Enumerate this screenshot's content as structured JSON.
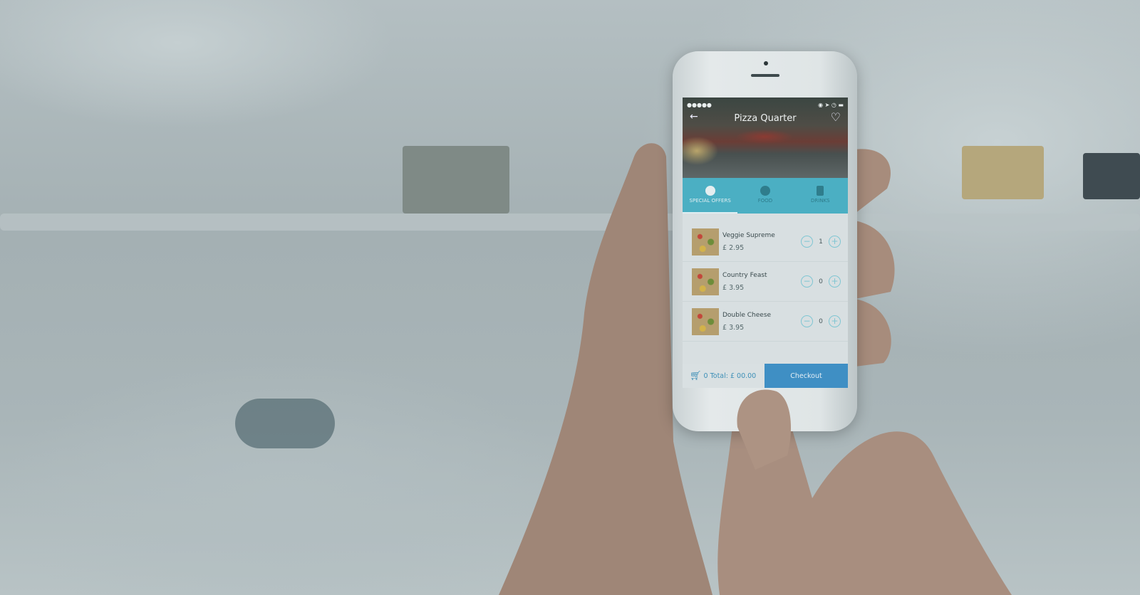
{
  "app": {
    "title": "Pizza Quarter",
    "status": {
      "signal": "●●●●●",
      "right_icons": "◉ ➤ ◷ ▬"
    },
    "icons": {
      "back": "arrow-left",
      "favorite": "heart-outline",
      "cart": "shopping-cart"
    },
    "tabs": [
      {
        "label": "SPECIAL OFFERS",
        "icon": "badge",
        "active": true
      },
      {
        "label": "FOOD",
        "icon": "fork-knife",
        "active": false
      },
      {
        "label": "DRINKS",
        "icon": "cocktail",
        "active": false
      }
    ],
    "items": [
      {
        "name": "Veggie Supreme",
        "price": "£ 2.95",
        "qty": "1"
      },
      {
        "name": "Country Feast",
        "price": "£ 3.95",
        "qty": "0"
      },
      {
        "name": "Double Cheese",
        "price": "£ 3.95",
        "qty": "0"
      }
    ],
    "footer": {
      "cart_count": "0",
      "total": "Total: £ 00.00",
      "checkout": "Checkout"
    },
    "colors": {
      "accent": "#4bafc3",
      "checkout": "#3f8fc4"
    }
  }
}
